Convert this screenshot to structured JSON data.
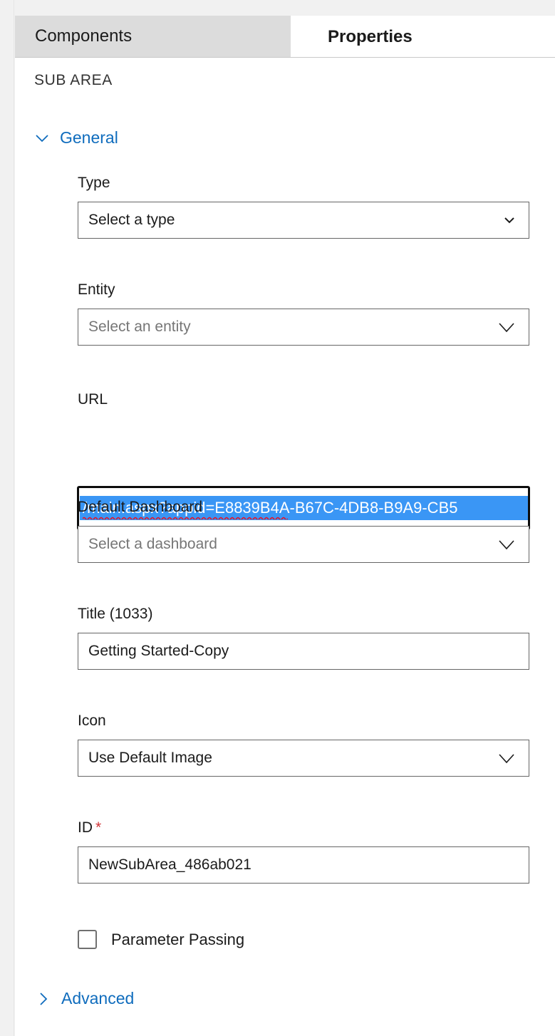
{
  "tabs": [
    {
      "label": "Components",
      "active": false
    },
    {
      "label": "Properties",
      "active": true
    }
  ],
  "panel": {
    "section_title": "SUB AREA"
  },
  "groups": {
    "general": {
      "label": "General",
      "expanded": true,
      "icon": "chevron-down-icon"
    },
    "advanced": {
      "label": "Advanced",
      "expanded": false,
      "icon": "chevron-right-icon"
    }
  },
  "fields": {
    "type": {
      "label": "Type",
      "value": "Select a type",
      "is_placeholder": false,
      "control": "select",
      "chevron": "chevron-down-icon"
    },
    "entity": {
      "label": "Entity",
      "value": "Select an entity",
      "is_placeholder": true,
      "control": "combobox",
      "chevron": "chevron-down-icon"
    },
    "url": {
      "label": "URL",
      "value": "/main.aspx?appid=E8839B4A-B67C-4DB8-B9A9-CB5",
      "control": "text",
      "focused": true,
      "selected": true,
      "spellcheck_flagged": true
    },
    "default_dashboard": {
      "label": "Default Dashboard",
      "value": "Select a dashboard",
      "is_placeholder": true,
      "control": "combobox",
      "chevron": "chevron-down-icon"
    },
    "title": {
      "label": "Title (1033)",
      "value": "Getting Started-Copy",
      "control": "text"
    },
    "icon": {
      "label": "Icon",
      "value": "Use Default Image",
      "is_placeholder": false,
      "control": "combobox",
      "chevron": "chevron-down-icon"
    },
    "id": {
      "label": "ID",
      "required_marker": "*",
      "value": "NewSubArea_486ab021",
      "control": "text"
    },
    "parameter_passing": {
      "label": "Parameter Passing",
      "checked": false,
      "control": "checkbox"
    }
  },
  "colors": {
    "accent_link": "#0f6cbd",
    "selection_highlight": "#3a96f5",
    "required_asterisk": "#d13438",
    "spellcheck_underline": "#e81123",
    "tab_inactive_bg": "#dcdcdc",
    "panel_bg": "#ffffff",
    "chrome_bg": "#f1f1f1",
    "field_border": "#666666",
    "focus_border": "#0d0d0d"
  }
}
